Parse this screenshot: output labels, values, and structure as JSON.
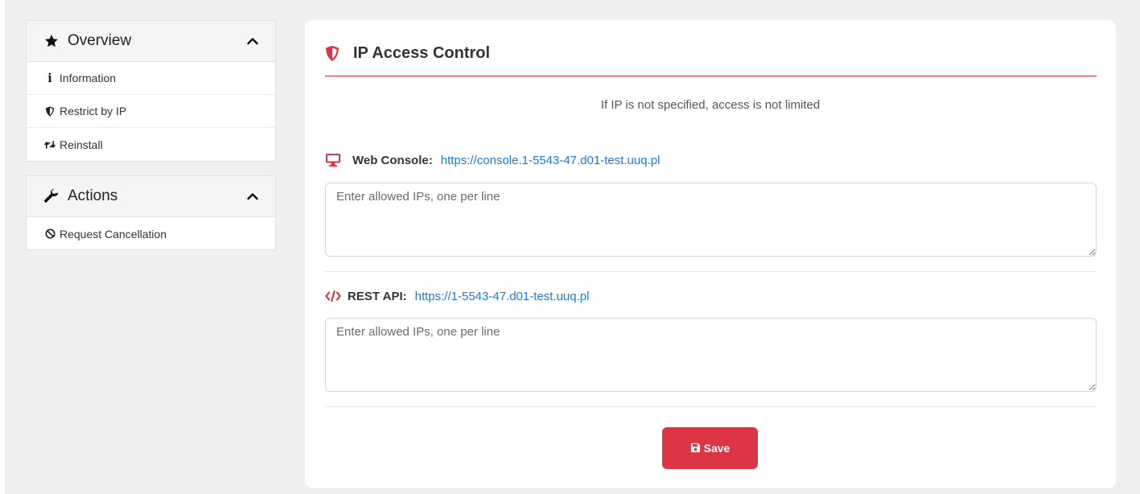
{
  "sidebar": {
    "overview": {
      "title": "Overview",
      "icon": "star-icon",
      "items": [
        {
          "label": "Information",
          "icon": "info-icon"
        },
        {
          "label": "Restrict by IP",
          "icon": "shield-icon"
        },
        {
          "label": "Reinstall",
          "icon": "retweet-icon"
        }
      ]
    },
    "actions": {
      "title": "Actions",
      "icon": "wrench-icon",
      "items": [
        {
          "label": "Request Cancellation",
          "icon": "ban-icon"
        }
      ]
    }
  },
  "main": {
    "title": "IP Access Control",
    "note": "If IP is not specified, access is not limited",
    "web_console": {
      "label": "Web Console:",
      "url": "https://console.1-5543-47.d01-test.uuq.pl",
      "placeholder": "Enter allowed IPs, one per line",
      "value": ""
    },
    "rest_api": {
      "label": "REST API:",
      "url": "https://1-5543-47.d01-test.uuq.pl",
      "placeholder": "Enter allowed IPs, one per line",
      "value": ""
    },
    "save_label": "Save"
  },
  "colors": {
    "accent": "#dc3545",
    "link": "#1a7bd9",
    "background": "#f0f0f0"
  }
}
